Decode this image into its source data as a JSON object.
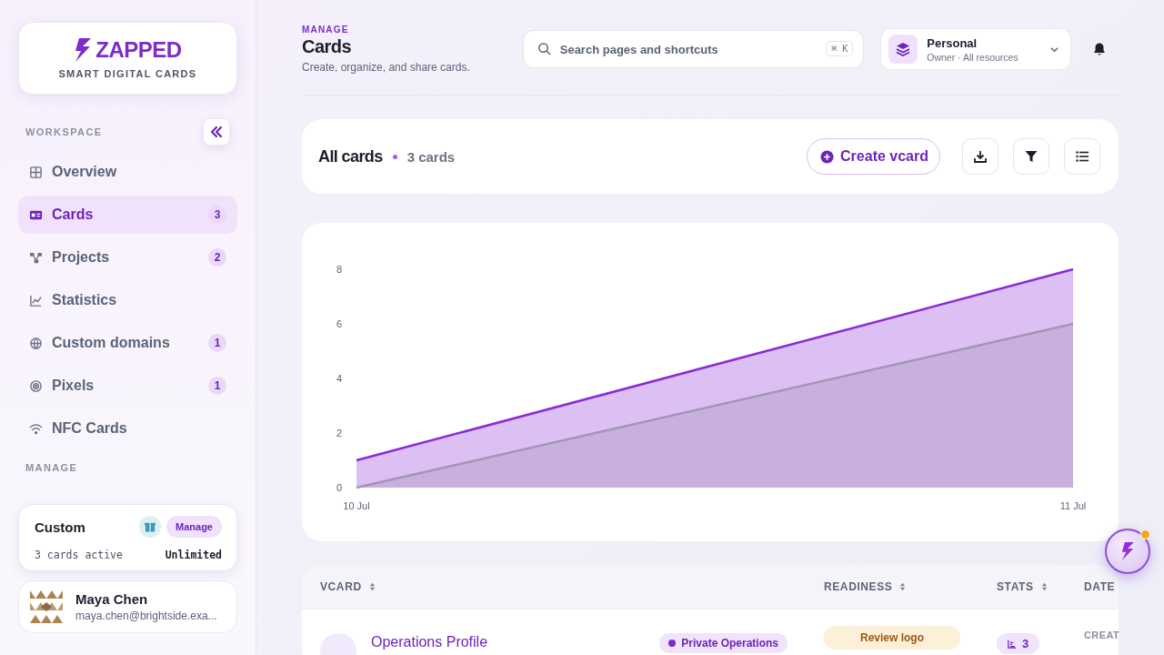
{
  "brand": {
    "name": "ZAPPED",
    "tagline": "SMART DIGITAL CARDS"
  },
  "sidebar": {
    "sections": [
      {
        "label": "WORKSPACE",
        "items": [
          {
            "label": "Overview",
            "selected": false
          },
          {
            "label": "Cards",
            "selected": true,
            "count": "3"
          },
          {
            "label": "Projects",
            "selected": false,
            "count": "2"
          },
          {
            "label": "Statistics",
            "selected": false
          },
          {
            "label": "Custom domains",
            "selected": false,
            "count": "1"
          },
          {
            "label": "Pixels",
            "selected": false,
            "count": "1"
          },
          {
            "label": "NFC Cards",
            "selected": false
          }
        ]
      },
      {
        "label": "MANAGE"
      }
    ]
  },
  "plan": {
    "name": "Custom",
    "action": "Manage",
    "usage": "3 cards active",
    "limit": "Unlimited"
  },
  "user": {
    "name": "Maya Chen",
    "email": "maya.chen@brightside.exa..."
  },
  "header": {
    "eyebrow": "MANAGE",
    "title": "Cards",
    "subtitle": "Create, organize, and share cards."
  },
  "search": {
    "placeholder": "Search pages and shortcuts",
    "shortcut": "⌘ K"
  },
  "account": {
    "name": "Personal",
    "role": "Owner · All resources"
  },
  "toolbar": {
    "title": "All cards",
    "count": "3 cards",
    "create": "Create vcard"
  },
  "chart_data": {
    "type": "area",
    "categories": [
      "10 Jul",
      "11 Jul"
    ],
    "series": [
      {
        "color": "#8a2bd6",
        "values": [
          1,
          8
        ]
      },
      {
        "color": "#a394b8",
        "values": [
          0,
          6
        ]
      }
    ],
    "ylim": [
      0,
      8
    ],
    "yticks": [
      0,
      2,
      4,
      6,
      8
    ]
  },
  "table": {
    "columns": [
      "VCARD",
      "READINESS",
      "STATS",
      "DATE"
    ],
    "rows": [
      {
        "name": "Operations Profile",
        "tag": "Private Operations",
        "readiness": "Review logo",
        "stats": "3",
        "dates": "CREAT"
      }
    ]
  }
}
